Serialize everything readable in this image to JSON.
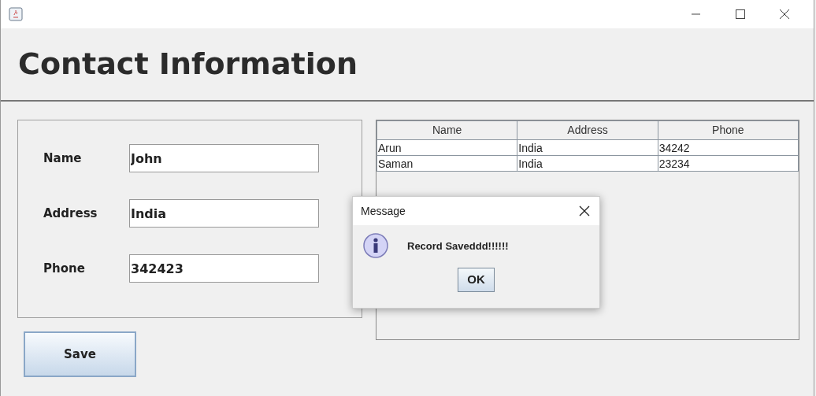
{
  "heading": "Contact Information",
  "form": {
    "fields": [
      {
        "label": "Name",
        "value": "John"
      },
      {
        "label": "Address",
        "value": "India"
      },
      {
        "label": "Phone",
        "value": "342423"
      }
    ]
  },
  "save_button": "Save",
  "table": {
    "columns": [
      "Name",
      "Address",
      "Phone"
    ],
    "rows": [
      [
        "Arun",
        "India",
        "34242"
      ],
      [
        "Saman",
        "India",
        "23234"
      ]
    ]
  },
  "dialog": {
    "title": "Message",
    "message": "Record Saveddd!!!!!!",
    "button": "OK"
  }
}
